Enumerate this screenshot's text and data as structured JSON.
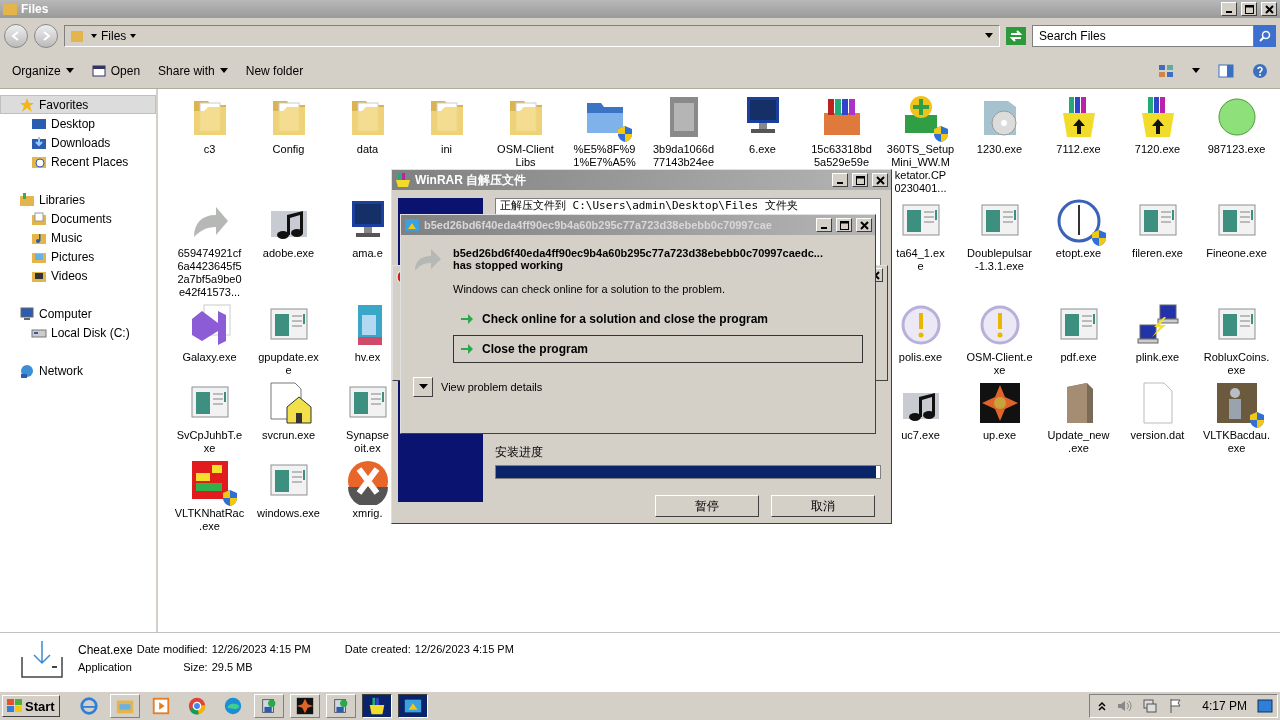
{
  "window": {
    "title": "Files"
  },
  "address": {
    "crumb": "Files",
    "search_placeholder": "Search Files"
  },
  "toolbar": [
    {
      "label": "Organize",
      "kind": "menu"
    },
    {
      "label": "Open",
      "kind": "open"
    },
    {
      "label": "Share with",
      "kind": "menu"
    },
    {
      "label": "New folder",
      "kind": "plain"
    }
  ],
  "sidebar": [
    {
      "label": "Favorites",
      "kind": "star",
      "selected": true,
      "children": [
        {
          "label": "Desktop",
          "kind": "desktop",
          "selected": false
        },
        {
          "label": "Downloads",
          "kind": "downloads",
          "selected": false
        },
        {
          "label": "Recent Places",
          "kind": "recent",
          "selected": false
        }
      ]
    },
    {
      "label": "Libraries",
      "kind": "library",
      "selected": false,
      "children": [
        {
          "label": "Documents",
          "kind": "documents",
          "selected": false
        },
        {
          "label": "Music",
          "kind": "music",
          "selected": false
        },
        {
          "label": "Pictures",
          "kind": "pictures",
          "selected": false
        },
        {
          "label": "Videos",
          "kind": "videos",
          "selected": false
        }
      ]
    },
    {
      "label": "Computer",
      "kind": "computer",
      "selected": false,
      "children": [
        {
          "label": "Local Disk (C:)",
          "kind": "disk",
          "selected": false
        }
      ]
    },
    {
      "label": "Network",
      "kind": "network",
      "selected": false
    }
  ],
  "grid": {
    "rows": [
      {
        "left": [
          {
            "label": "c3",
            "kind": "folder",
            "shield": false
          },
          {
            "label": "Config",
            "kind": "folder",
            "shield": false
          },
          {
            "label": "data",
            "kind": "folder",
            "shield": false
          },
          {
            "label": "ini",
            "kind": "folder",
            "shield": false
          },
          {
            "label": "OSM-Client\nLibs",
            "kind": "folder",
            "shield": false
          },
          {
            "label": "%E5%8F%9\n1%E7%A5%",
            "kind": "shared-folder",
            "shield": true
          },
          {
            "label": "3b9da1066d\n77143b24ee",
            "kind": "tile",
            "shield": false
          },
          {
            "label": "6.exe",
            "kind": "monitor",
            "shield": false
          },
          {
            "label": "15c63318bd\n5a529e59e",
            "kind": "package",
            "shield": false
          },
          {
            "label": "360TS_Setup\nMini_WW.M\nketator.CP\n0230401...",
            "kind": "installer",
            "shield": true
          },
          {
            "label": "1230.exe",
            "kind": "disc",
            "shield": false
          },
          {
            "label": "7112.exe",
            "kind": "archive",
            "shield": false
          },
          {
            "label": "7120.exe",
            "kind": "archive",
            "shield": false
          },
          {
            "label": "987123.exe",
            "kind": "orb",
            "shield": false
          }
        ],
        "right": []
      },
      {
        "left": [
          {
            "label": "659474921cf\n6a4423645f5\n2a7bf5a9be0\ne42f41573...",
            "kind": "shortcut",
            "shield": false
          },
          {
            "label": "adobe.exe",
            "kind": "music",
            "shield": false
          },
          {
            "label": "ama.e",
            "kind": "monitor",
            "shield": false
          }
        ],
        "right": [
          {
            "label": "ta64_1.ex\ne",
            "kind": "window",
            "shield": false
          },
          {
            "label": "Doublepulsar\n-1.3.1.exe",
            "kind": "window",
            "shield": false
          },
          {
            "label": "etopt.exe",
            "kind": "clock",
            "shield": true
          },
          {
            "label": "fileren.exe",
            "kind": "window",
            "shield": false
          },
          {
            "label": "Fineone.exe",
            "kind": "window",
            "shield": false
          }
        ]
      },
      {
        "left": [
          {
            "label": "Galaxy.exe",
            "kind": "ribbon",
            "shield": false
          },
          {
            "label": "gpupdate.ex\ne",
            "kind": "window",
            "shield": false
          },
          {
            "label": "hv.ex",
            "kind": "boxart",
            "shield": false
          }
        ],
        "right": [
          {
            "label": "polis.exe",
            "kind": "alert",
            "shield": false
          },
          {
            "label": "OSM-Client.e\nxe",
            "kind": "alert",
            "shield": false
          },
          {
            "label": "pdf.exe",
            "kind": "window",
            "shield": false
          },
          {
            "label": "plink.exe",
            "kind": "plink",
            "shield": false
          },
          {
            "label": "RobluxCoins.\nexe",
            "kind": "window",
            "shield": false
          }
        ]
      },
      {
        "left": [
          {
            "label": "SvCpJuhbT.e\nxe",
            "kind": "window",
            "shield": false
          },
          {
            "label": "svcrun.exe",
            "kind": "house-document",
            "shield": false
          },
          {
            "label": "Synapse\noit.ex",
            "kind": "window",
            "shield": false
          }
        ],
        "right": [
          {
            "label": "uc7.exe",
            "kind": "music",
            "shield": false
          },
          {
            "label": "up.exe",
            "kind": "emblem",
            "shield": false
          },
          {
            "label": "Update_new\n.exe",
            "kind": "crate",
            "shield": false
          },
          {
            "label": "version.dat",
            "kind": "document",
            "shield": false
          },
          {
            "label": "VLTKBacdau.\nexe",
            "kind": "figure",
            "shield": true
          }
        ]
      },
      {
        "left": [
          {
            "label": "VLTKNhatRac\n.exe",
            "kind": "mosaic",
            "shield": true
          },
          {
            "label": "windows.exe",
            "kind": "window",
            "shield": false
          },
          {
            "label": "xmrig.",
            "kind": "x-logo",
            "shield": false
          }
        ],
        "right": []
      }
    ]
  },
  "details": {
    "name": "Cheat.exe",
    "type": "Application",
    "modified_label": "Date modified:",
    "modified": "12/26/2023 4:15 PM",
    "size_label": "Size:",
    "size": "29.5 MB",
    "created_label": "Date created:",
    "created": "12/26/2023 4:15 PM"
  },
  "winrar_dialog": {
    "title": "WinRAR 自解压文件",
    "path_text": "正解压文件到 C:\\Users\\admin\\Desktop\\Files 文件夹",
    "progress_label": "安装进度",
    "level": 0.99,
    "buttons": [
      "暂停",
      "取消"
    ]
  },
  "crash_dialog": {
    "title": "b5ed26bd6f40eda4ff90ec9b4a60b295c77a723d38ebebb0c70997cae",
    "heading": "b5ed26bd6f40eda4ff90ec9b4a60b295c77a723d38ebebb0c70997caedc...",
    "subheading": "has stopped working",
    "message": "Windows can check online for a solution to the problem.",
    "options": [
      {
        "label": "Check online for a solution and close the program",
        "selected": false
      },
      {
        "label": "Close the program",
        "selected": true
      }
    ],
    "details_label": "View problem details"
  },
  "taskbar": {
    "start": "Start",
    "buttons": [
      {
        "kind": "browser",
        "running": false,
        "selected": false
      },
      {
        "kind": "folder",
        "running": true,
        "selected": false
      },
      {
        "kind": "player",
        "running": false,
        "selected": false
      },
      {
        "kind": "chrome",
        "running": false,
        "selected": false
      },
      {
        "kind": "edge",
        "running": false,
        "selected": false
      },
      {
        "kind": "setup",
        "running": true,
        "selected": false
      },
      {
        "kind": "emblem",
        "running": true,
        "selected": false
      },
      {
        "kind": "setup",
        "running": true,
        "selected": false
      },
      {
        "kind": "archive",
        "running": true,
        "selected": true
      },
      {
        "kind": "crash",
        "running": true,
        "selected": true
      }
    ],
    "clock": "4:17 PM"
  }
}
